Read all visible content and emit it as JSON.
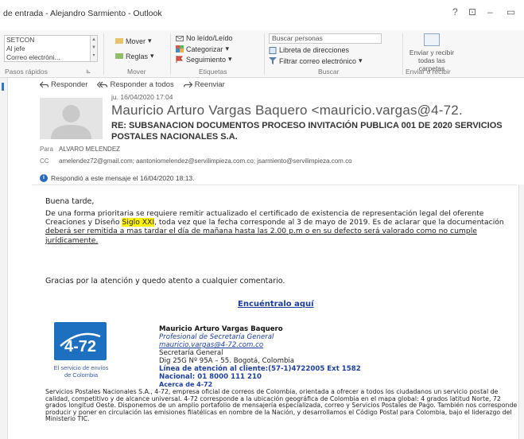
{
  "window": {
    "title": "de entrada - Alejandro Sarmiento - Outlook",
    "help": "?",
    "restore": "⊡",
    "minimize": "–",
    "maximize": "▭"
  },
  "ribbon": {
    "quick_steps": [
      "SETCON",
      "Al jefe",
      "Correo electróni..."
    ],
    "quick_steps_label": "Pasos rápidos",
    "move": {
      "move_label": "Mover",
      "rules_label": "Reglas",
      "group_label": "Mover"
    },
    "tags": {
      "unread_label": "No leído/Leído",
      "categorize_label": "Categorizar",
      "followup_label": "Seguimiento",
      "group_label": "Etiquetas"
    },
    "find": {
      "search_placeholder": "Buscar personas",
      "address_book": "Libreta de direcciones",
      "filter_email": "Filtrar correo electrónico",
      "group_label": "Buscar"
    },
    "send_receive": {
      "button_label": "Enviar y recibir todas las carpetas",
      "group_label": "Enviar o recibir"
    }
  },
  "message": {
    "actions": {
      "reply": "Responder",
      "reply_all": "Responder a todos",
      "forward": "Reenviar"
    },
    "date": "ju. 16/04/2020 17:04",
    "sender": "Mauricio Arturo Vargas Baquero <mauricio.vargas@4-72.",
    "subject": "RE: SUBSANACION DOCUMENTOS PROCESO INVITACIÓN PUBLICA 001 DE 2020 SERVICIOS POSTALES NACIONALES S.A.",
    "to_label": "Para",
    "to": "ALVARO MELENDEZ",
    "cc_label": "CC",
    "cc": "amelendez72@gmail.com; aantoniomelendez@servilimpieza.com.co; jsarmiento@servilimpieza.com.co",
    "info_bar": "Respondió a este mensaje el 16/04/2020 18:13.",
    "info_icon": "i"
  },
  "body": {
    "greeting": "Buena tarde,",
    "para_1": "De una forma prioritaria se requiere remitir actualizado el certificado de existencia de representación legal del oferente  Creaciones y Diseño ",
    "para_highlight": "Siglo XXI",
    "para_2": ", toda vez que la fecha corresponde al 3 de mayo de 2019. Es de aclarar que la documentación ",
    "para_underline": "deberá ser remitida a mas tardar el día de mañana hasta las 2.00 p.m o en su defecto será valorado como no cumple jurídicamente.",
    "thanks": "Gracias por la atención y quedo atento a cualquier comentario.",
    "link": "Encuéntralo aquí"
  },
  "signature": {
    "logo_text": "4-72",
    "logo_caption_1": "El servicio de envíos",
    "logo_caption_2": "de Colombia",
    "name": "Mauricio Arturo Vargas Baquero",
    "role": "Profesional de Secretaría General",
    "email": "mauricio.vargas@4-72.com.co",
    "dept": "Secretaría General",
    "address": "Dig 25G Nº 95A – 55. Bogotá, Colombia",
    "hotline": "Línea de atención al cliente:(57-1)4722005 Ext 1582",
    "national": "Nacional: 01 8000 111 210",
    "about_title": "Acerca de 4-72",
    "about": "Servicios Postales Nacionales S.A., 4-72, empresa oficial de correos de Colombia, orientada a ofrecer a todos los ciudadanos un servicio postal de calidad, competitivo y de alcance universal. 4-72 corresponde a la ubicación geográfica de Colombia en el mapa global: 4 grados latitud Norte, 72 grados longitud Oeste. Disponemos de un amplio portafolio de mensajería especializada, correo y Servicios Postales de Pago. También nos corresponde producir y poner en circulación las emisiones filatélicas en nombre de la Nación, y desarrollamos el Código Postal para Colombia, bajo el liderazgo del Ministerio TIC."
  },
  "colors": {
    "accent": "#2b79c6",
    "link": "#1a3d9c",
    "logo": "#1d6fc0",
    "highlight": "#fff200"
  }
}
